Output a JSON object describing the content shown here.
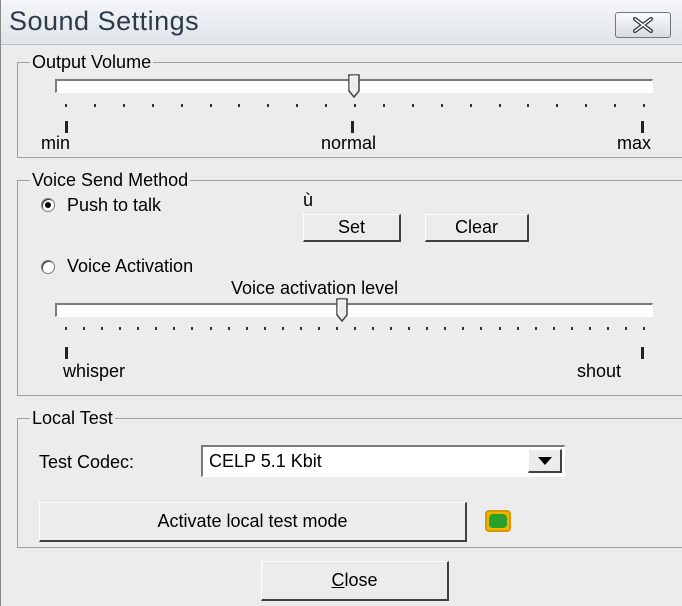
{
  "window": {
    "title": "Sound Settings"
  },
  "output_volume": {
    "legend": "Output Volume",
    "min_label": "min",
    "normal_label": "normal",
    "max_label": "max",
    "level": 0.5
  },
  "voice_send": {
    "legend": "Voice Send Method",
    "push_to_talk_label": "Push to talk",
    "push_to_talk_selected": true,
    "hotkey_value": "ù",
    "set_label": "Set",
    "clear_label": "Clear",
    "voice_activation_label": "Voice Activation",
    "voice_activation_selected": false,
    "activation_level_title": "Voice activation level",
    "whisper_label": "whisper",
    "shout_label": "shout",
    "activation_level": 0.48
  },
  "local_test": {
    "legend": "Local Test",
    "codec_label": "Test Codec:",
    "codec_value": "CELP 5.1 Kbit",
    "activate_label": "Activate local test mode",
    "indicator_color": "#2aa12a"
  },
  "footer": {
    "close_label": "Close",
    "close_accesskey": "C",
    "close_rest": "lose"
  }
}
